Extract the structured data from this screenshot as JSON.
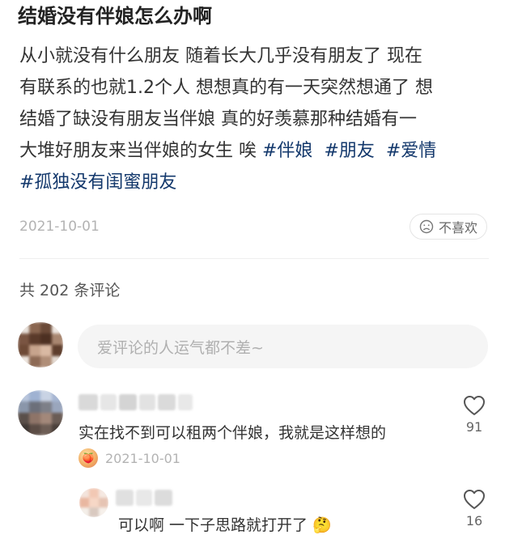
{
  "post": {
    "title": "结婚没有伴娘怎么办啊",
    "lines": [
      "从小就没有什么朋友  随着长大几乎没有朋友了  现在",
      "有联系的也就1.2个人  想想真的有一天突然想通了 想",
      "结婚了缺没有朋友当伴娘   真的好羡慕那种结婚有一",
      "大堆好朋友来当伴娘的女生  唉 "
    ],
    "tags_line4": [
      "#伴娘",
      "#朋友",
      "#爱情"
    ],
    "tags_line5": [
      "#孤独没有闺蜜朋友"
    ],
    "date": "2021-10-01",
    "dislike_label": "不喜欢"
  },
  "comments_header": "共 202 条评论",
  "comment_input": {
    "placeholder": "爱评论的人运气都不差~"
  },
  "comments": [
    {
      "text": "实在找不到可以租两个伴娘，我就是这样想的",
      "date": "2021-10-01",
      "likes": "91"
    },
    {
      "text": "可以啊 一下子思路就打开了",
      "likes": "16"
    }
  ],
  "colors": {
    "tag": "#13386c",
    "muted": "#b3b3b3",
    "input_bg": "#f5f5f5"
  },
  "icons": {
    "dislike": "sad-face-icon",
    "like": "heart-outline-icon"
  }
}
